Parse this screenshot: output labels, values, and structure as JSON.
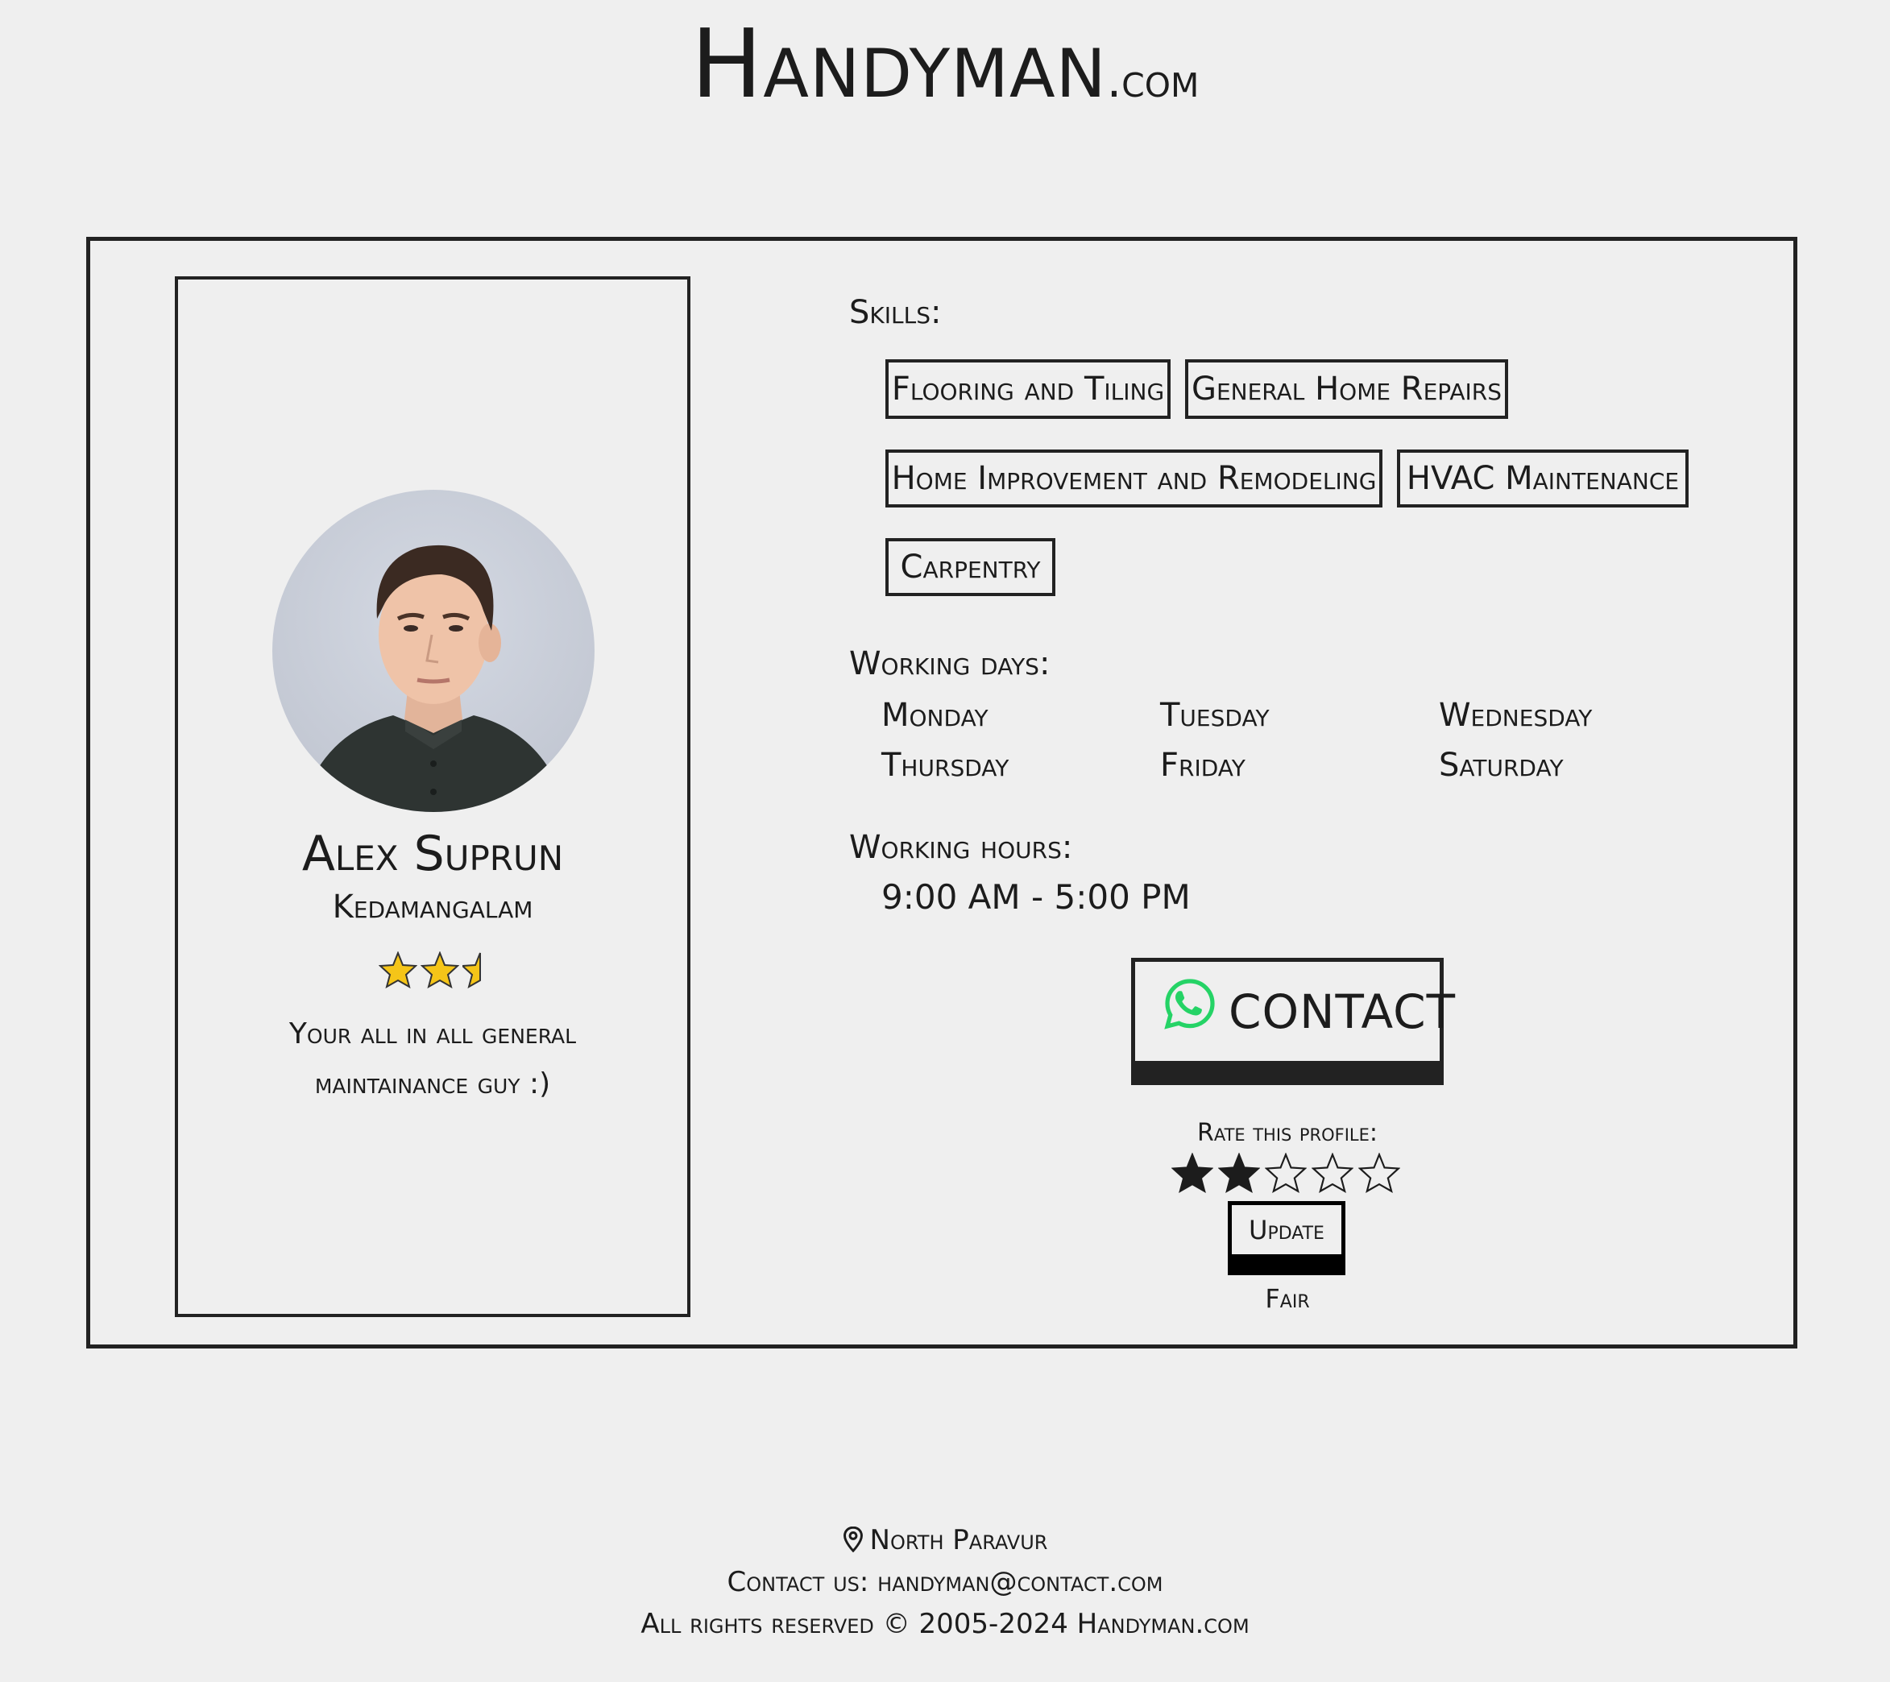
{
  "header": {
    "brand_main": "Handyman",
    "brand_tld": ".com"
  },
  "profile": {
    "name": "Alex Suprun",
    "location": "Kedamangalam",
    "average_rating": 2.5,
    "rating_max": 5,
    "rating_color": "#f5c518",
    "bio": "Your all in all general maintainance guy :)"
  },
  "skills": {
    "label": "Skills:",
    "items": [
      "Flooring and Tiling",
      "General Home Repairs",
      "Home Improvement and Remodeling",
      "HVAC Maintenance",
      "Carpentry"
    ]
  },
  "working_days": {
    "label": "Working days:",
    "days": [
      "Monday",
      "Tuesday",
      "Wednesday",
      "Thursday",
      "Friday",
      "Saturday"
    ]
  },
  "working_hours": {
    "label": "Working hours:",
    "value": "9:00 AM - 5:00 PM"
  },
  "contact": {
    "label": "CONTACT",
    "icon": "whatsapp-icon",
    "icon_color": "#25d366"
  },
  "rate": {
    "label": "Rate this profile:",
    "selected": 2,
    "max": 5,
    "update_label": "Update",
    "result_text": "Fair"
  },
  "footer": {
    "location_icon": "map-pin-icon",
    "location": "North Paravur",
    "contact": "Contact us: handyman@contact.com",
    "rights": "All rights reserved © 2005-2024 Handyman.com"
  }
}
